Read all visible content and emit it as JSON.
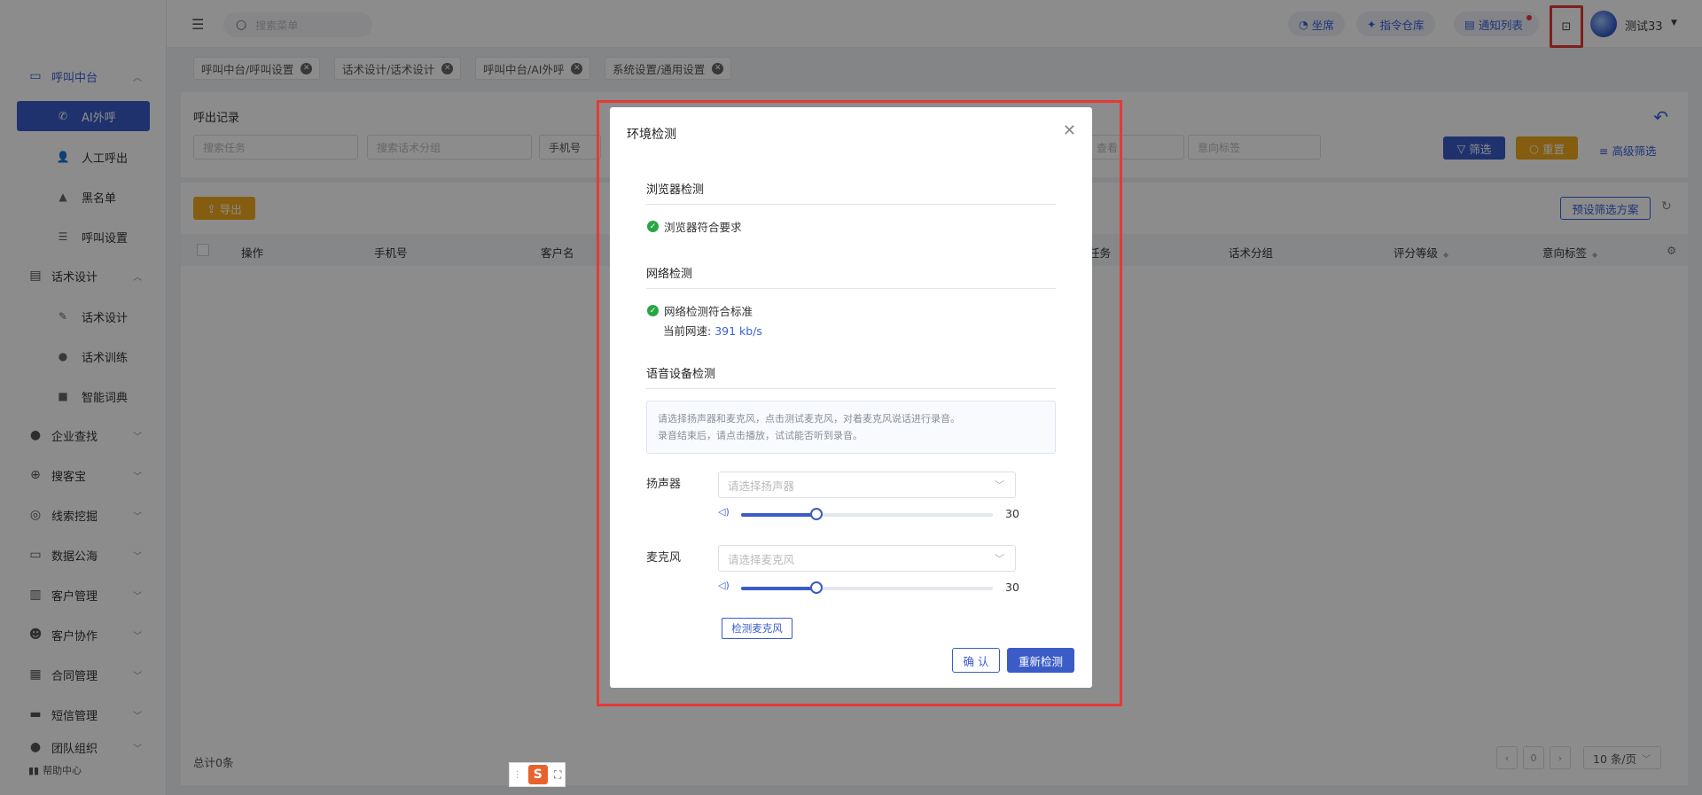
{
  "colors": {
    "accent": "#3b5cc7",
    "warn": "#f0a91e",
    "success": "#27a644",
    "annotation": "#e53935"
  },
  "sidebar": {
    "groups": [
      {
        "label": "呼叫中台",
        "icon": "monitor-icon"
      },
      {
        "label": "话术设计",
        "icon": "book-icon"
      },
      {
        "label": "企业查找",
        "icon": "bulb-icon"
      },
      {
        "label": "搜客宝",
        "icon": "search-icon"
      },
      {
        "label": "线索挖掘",
        "icon": "target-icon"
      },
      {
        "label": "数据公海",
        "icon": "chart-icon"
      },
      {
        "label": "客户管理",
        "icon": "customer-icon"
      },
      {
        "label": "客户协作",
        "icon": "collab-icon"
      },
      {
        "label": "合同管理",
        "icon": "contract-icon"
      },
      {
        "label": "短信管理",
        "icon": "sms-icon"
      },
      {
        "label": "团队组织",
        "icon": "team-icon"
      }
    ],
    "call_items": [
      {
        "label": "AI外呼",
        "icon": "phone-icon"
      },
      {
        "label": "人工呼出",
        "icon": "person-icon"
      },
      {
        "label": "黑名单",
        "icon": "warning-icon"
      },
      {
        "label": "呼叫设置",
        "icon": "sliders-icon"
      }
    ],
    "script_items": [
      {
        "label": "话术设计",
        "icon": "pen-icon"
      },
      {
        "label": "话术训练",
        "icon": "chat-icon"
      },
      {
        "label": "智能词典",
        "icon": "dictionary-icon"
      }
    ],
    "help": "帮助中心"
  },
  "header": {
    "search_placeholder": "搜索菜单",
    "seat": "坐席",
    "warehouse": "指令仓库",
    "notify": "通知列表",
    "user": "测试33"
  },
  "tabs": [
    "呼叫中台/呼叫设置",
    "话术设计/话术设计",
    "呼叫中台/AI外呼",
    "系统设置/通用设置"
  ],
  "main": {
    "title": "呼出记录",
    "filters": {
      "task": "搜索任务",
      "group": "搜索话术分组",
      "phone": "手机号",
      "view": "查看",
      "intent": "意向标签"
    },
    "filter_btn": "筛选",
    "reset_btn": "重置",
    "advanced": "高级筛选",
    "export_btn": "导出",
    "preset_btn": "预设筛选方案",
    "columns": [
      "操作",
      "手机号",
      "客户名",
      "任务",
      "话术分组",
      "评分等级",
      "意向标签"
    ],
    "total": "总计0条",
    "page": "0",
    "page_size": "10 条/页"
  },
  "modal": {
    "title": "环境检测",
    "browser_section": "浏览器检测",
    "browser_ok": "浏览器符合要求",
    "network_section": "网络检测",
    "network_ok": "网络检测符合标准",
    "speed_label": "当前网速:",
    "speed_value": "391 kb/s",
    "voice_section": "语音设备检测",
    "tip_line1": "请选择扬声器和麦克风，点击测试麦克风，对着麦克风说话进行录音。",
    "tip_line2": "录音结束后，请点击播放，试试能否听到录音。",
    "speaker_label": "扬声器",
    "speaker_placeholder": "请选择扬声器",
    "speaker_volume": 30,
    "speaker_volume_text": "30",
    "mic_label": "麦克风",
    "mic_placeholder": "请选择麦克风",
    "mic_volume": 30,
    "mic_volume_text": "30",
    "detect_mic": "检测麦克风",
    "confirm": "确 认",
    "retry": "重新检测"
  }
}
